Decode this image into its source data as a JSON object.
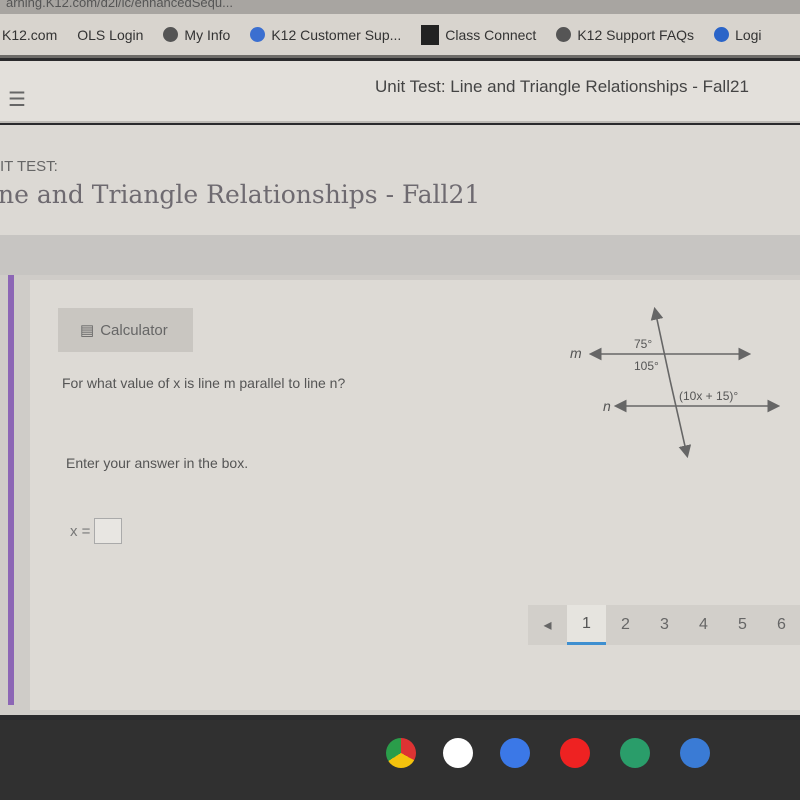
{
  "browser": {
    "url": "arning.K12.com/d2l/lc/enhancedSequ...",
    "bookmarks": [
      "K12.com",
      "OLS Login",
      "My Info",
      "K12 Customer Sup...",
      "Class Connect",
      "K12 Support FAQs",
      "Logi"
    ]
  },
  "header": {
    "title": "Unit Test: Line and Triangle Relationships - Fall21"
  },
  "page": {
    "subtitle": "IT TEST:",
    "title": "ne and Triangle Relationships - Fall21"
  },
  "question": {
    "calculator_label": "Calculator",
    "prompt": "For what value of x is line m parallel to line n?",
    "instruction": "Enter your answer in the box.",
    "answer_label": "x =",
    "answer_value": ""
  },
  "diagram": {
    "line_m": "m",
    "line_n": "n",
    "angle_top": "75°",
    "angle_bottom": "105°",
    "angle_expr": "(10x + 15)°"
  },
  "pagination": {
    "prev": "◂",
    "pages": [
      "1",
      "2",
      "3",
      "4",
      "5",
      "6"
    ],
    "current": "1"
  },
  "taskbar": {
    "apps": [
      "chrome-icon",
      "gmail-icon",
      "docs-icon",
      "youtube-icon",
      "play-store-icon",
      "files-icon"
    ]
  }
}
